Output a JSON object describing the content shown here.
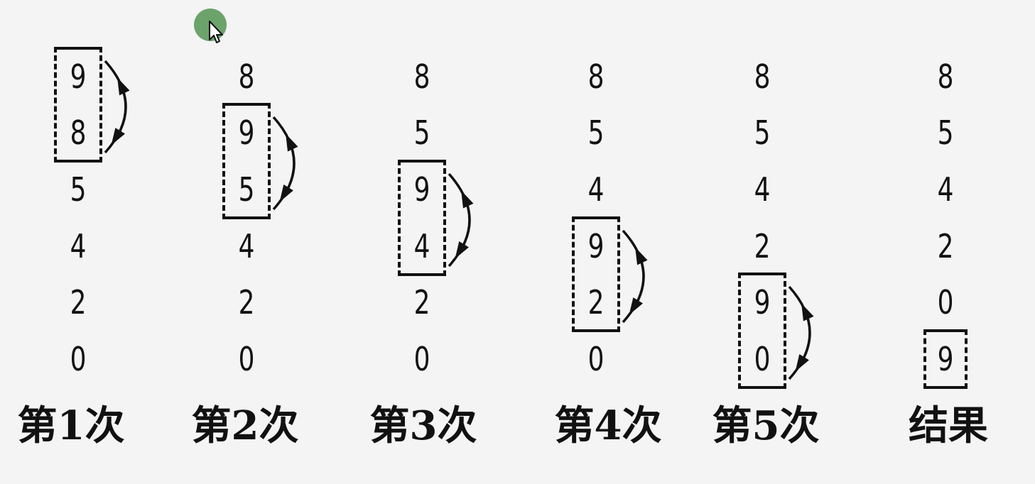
{
  "columns": [
    {
      "label": "第1次",
      "values": [
        "9",
        "8",
        "5",
        "4",
        "2",
        "0"
      ],
      "swap": [
        0,
        1
      ]
    },
    {
      "label": "第2次",
      "values": [
        "8",
        "9",
        "5",
        "4",
        "2",
        "0"
      ],
      "swap": [
        1,
        2
      ]
    },
    {
      "label": "第3次",
      "values": [
        "8",
        "5",
        "9",
        "4",
        "2",
        "0"
      ],
      "swap": [
        2,
        3
      ]
    },
    {
      "label": "第4次",
      "values": [
        "8",
        "5",
        "4",
        "9",
        "2",
        "0"
      ],
      "swap": [
        3,
        4
      ]
    },
    {
      "label": "第5次",
      "values": [
        "8",
        "5",
        "4",
        "2",
        "9",
        "0"
      ],
      "swap": [
        4,
        5
      ]
    },
    {
      "label": "结果",
      "values": [
        "8",
        "5",
        "4",
        "2",
        "0",
        "9"
      ],
      "swap": [
        5,
        5
      ]
    }
  ],
  "colors": {
    "ink": "#111111",
    "background": "#f4f4f4",
    "cursor": "#5c9a5c"
  },
  "icons": {
    "cursor": "mouse-pointer-icon"
  }
}
